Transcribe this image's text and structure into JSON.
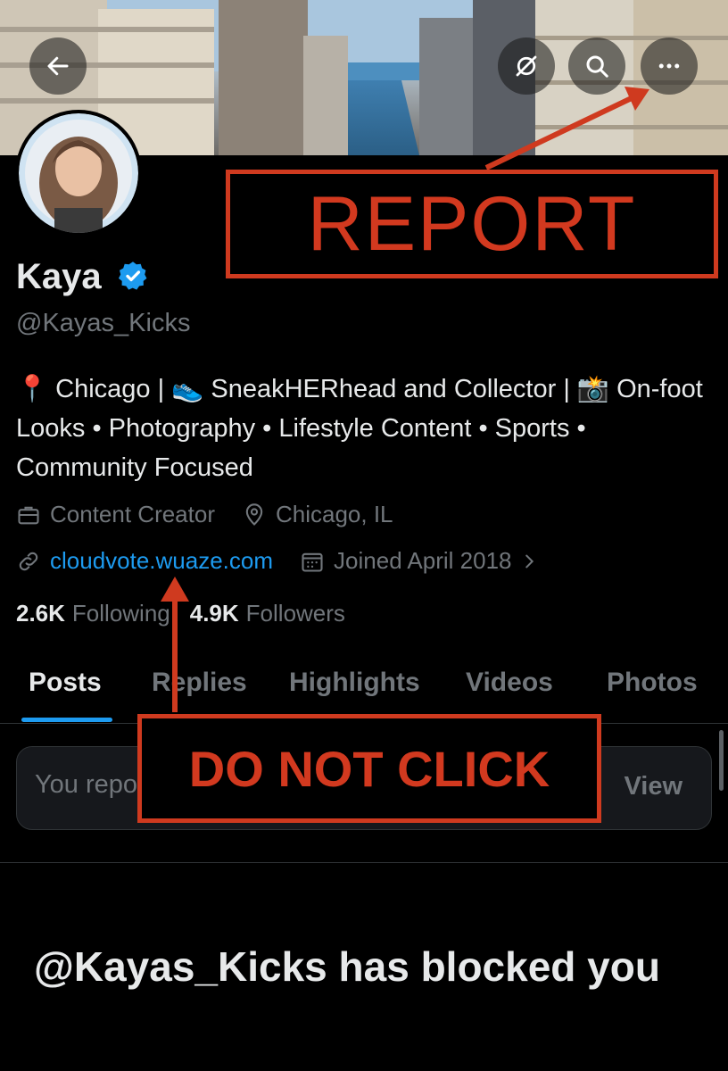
{
  "profile": {
    "display_name": "Kaya",
    "handle": "@Kayas_Kicks",
    "bio": "📍 Chicago | 👟 SneakHERhead and Collector | 📸 On-foot Looks • Photography • Lifestyle Content • Sports • Community Focused",
    "category": "Content Creator",
    "location": "Chicago, IL",
    "website": "cloudvote.wuaze.com",
    "joined": "Joined April 2018",
    "following_count": "2.6K",
    "following_label": "Following",
    "followers_count": "4.9K",
    "followers_label": "Followers"
  },
  "tabs": [
    {
      "label": "Posts",
      "active": true
    },
    {
      "label": "Replies",
      "active": false
    },
    {
      "label": "Highlights",
      "active": false
    },
    {
      "label": "Videos",
      "active": false
    },
    {
      "label": "Photos",
      "active": false
    }
  ],
  "notice": {
    "text": "You repo",
    "view_label": "View"
  },
  "blocked_message": "@Kayas_Kicks has blocked you",
  "annotations": {
    "report_label": "REPORT",
    "do_not_click_label": "DO NOT CLICK"
  },
  "icons": {
    "back": "arrow-left-icon",
    "hide_retweets": "retweet-off-icon",
    "search": "search-icon",
    "more": "more-horizontal-icon",
    "verified": "verified-badge-icon"
  },
  "colors": {
    "accent": "#1d9bf0",
    "annotation": "#cf3a1f",
    "background": "#000000",
    "muted": "#71767b"
  }
}
